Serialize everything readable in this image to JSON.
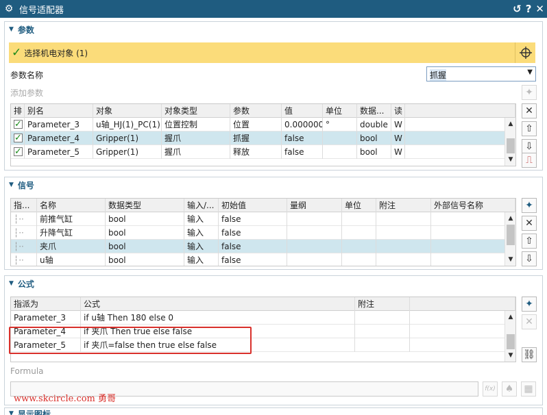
{
  "window": {
    "title": "信号适配器",
    "buttons": [
      "↺",
      "?",
      "✕"
    ]
  },
  "params_section": {
    "title": "参数",
    "select_object_label": "选择机电对象 (1)",
    "param_name_label": "参数名称",
    "param_name_value": "抓握",
    "add_param_label": "添加参数",
    "columns": [
      "排",
      "别名",
      "对象",
      "对象类型",
      "参数",
      "值",
      "单位",
      "数据...",
      "读"
    ],
    "rows": [
      [
        "",
        "Parameter_3",
        "u轴_HJ(1)_PC(1)",
        "位置控制",
        "位置",
        "0.000000",
        "°",
        "double",
        "W"
      ],
      [
        "",
        "Parameter_4",
        "Gripper(1)",
        "握爪",
        "抓握",
        "false",
        "",
        "bool",
        "W"
      ],
      [
        "",
        "Parameter_5",
        "Gripper(1)",
        "握爪",
        "释放",
        "false",
        "",
        "bool",
        "W"
      ]
    ]
  },
  "signals_section": {
    "title": "信号",
    "columns": [
      "指...",
      "名称",
      "数据类型",
      "输入/...",
      "初始值",
      "量纲",
      "单位",
      "附注",
      "外部信号名称"
    ],
    "rows": [
      [
        "",
        "前推气缸",
        "bool",
        "输入",
        "false",
        "",
        "",
        "",
        ""
      ],
      [
        "",
        "升降气缸",
        "bool",
        "输入",
        "false",
        "",
        "",
        "",
        ""
      ],
      [
        "",
        "夹爪",
        "bool",
        "输入",
        "false",
        "",
        "",
        "",
        ""
      ],
      [
        "",
        "u轴",
        "bool",
        "输入",
        "false",
        "",
        "",
        "",
        ""
      ]
    ]
  },
  "formula_section": {
    "title": "公式",
    "columns": [
      "指派为",
      "公式",
      "附注"
    ],
    "rows": [
      [
        "Parameter_3",
        "if u轴 Then 180 else 0",
        ""
      ],
      [
        "Parameter_4",
        "if 夹爪 Then true else false",
        ""
      ],
      [
        "Parameter_5",
        "if 夹爪=false then true else false",
        ""
      ]
    ],
    "formula_label": "Formula",
    "formula_value": "",
    "fx_label": "f(x)"
  },
  "watermark": "www.skcircle.com 勇哥",
  "bottom_section": {
    "title": "显示图标"
  },
  "colors": {
    "titlebar": "#1f5c80",
    "select_bar": "#fbdc7a",
    "selected_row": "#cfe6ee",
    "highlight_box": "#d9302b"
  }
}
